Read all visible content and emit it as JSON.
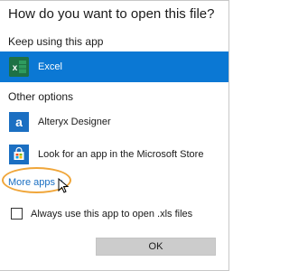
{
  "dialog": {
    "title": "How do you want to open this file?",
    "keep_label": "Keep using this app",
    "other_label": "Other options",
    "more_apps_label": "More apps",
    "more_apps_arrow": "↓",
    "checkbox_label": "Always use this app to open .xls files",
    "checkbox_checked": false,
    "ok_label": "OK"
  },
  "apps": {
    "current": {
      "label": "Excel",
      "icon": "excel-icon",
      "selected": true
    },
    "others": [
      {
        "label": "Alteryx Designer",
        "icon": "alteryx-icon",
        "glyph": "a"
      },
      {
        "label": "Look for an app in the Microsoft Store",
        "icon": "store-icon"
      }
    ]
  },
  "colors": {
    "accent": "#0b78d4",
    "link": "#1b6fc2",
    "highlight_ring": "#f0a63a",
    "excel_green": "#1e7145",
    "button_bg": "#cccccc"
  }
}
